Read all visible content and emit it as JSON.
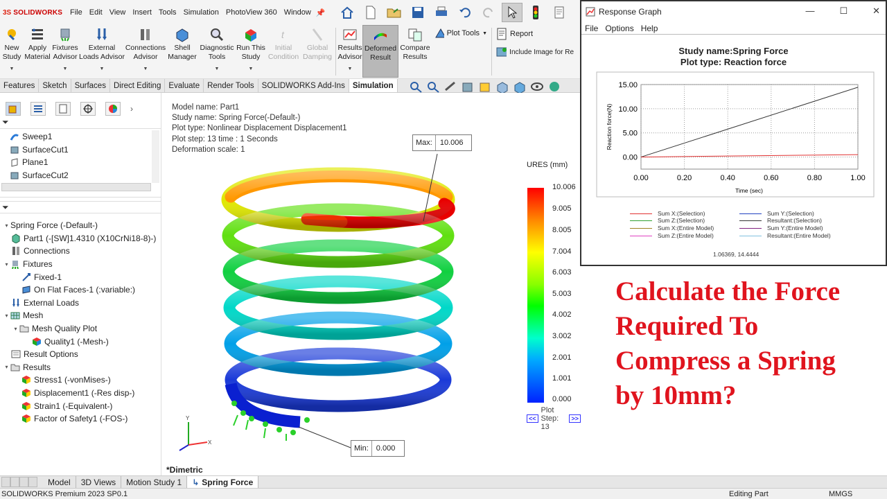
{
  "app": {
    "logo_prefix": "3S",
    "logo_text": "SOLIDWORKS",
    "menu": [
      "File",
      "Edit",
      "View",
      "Insert",
      "Tools",
      "Simulation",
      "PhotoView 360",
      "Window"
    ],
    "status_left": "SOLIDWORKS Premium 2023 SP0.1",
    "status_mid": "Editing Part",
    "status_units": "MMGS"
  },
  "commands": {
    "new_study": [
      "New",
      "Study"
    ],
    "apply_material": [
      "Apply",
      "Material"
    ],
    "fixtures_advisor": [
      "Fixtures",
      "Advisor"
    ],
    "external_loads_advisor": [
      "External",
      "Loads Advisor"
    ],
    "connections_advisor": [
      "Connections",
      "Advisor"
    ],
    "shell_manager": [
      "Shell",
      "Manager"
    ],
    "diagnostic_tools": [
      "Diagnostic",
      "Tools"
    ],
    "run_study": [
      "Run This",
      "Study"
    ],
    "initial_condition": [
      "Initial",
      "Condition"
    ],
    "global_damping": [
      "Global",
      "Damping"
    ],
    "results_advisor": [
      "Results",
      "Advisor"
    ],
    "deformed_result": [
      "Deformed",
      "Result"
    ],
    "compare_results": [
      "Compare",
      "Results"
    ],
    "plot_tools": "Plot Tools",
    "report": "Report",
    "include_image": "Include Image for Re"
  },
  "tabs": [
    "Features",
    "Sketch",
    "Surfaces",
    "Direct Editing",
    "Evaluate",
    "Render Tools",
    "SOLIDWORKS Add-Ins",
    "Simulation"
  ],
  "feature_tree": [
    "Sweep1",
    "SurfaceCut1",
    "Plane1",
    "SurfaceCut2"
  ],
  "study_tree": {
    "root": "Spring Force (-Default-)",
    "part": "Part1 (-[SW]1.4310 (X10CrNi18-8)-)",
    "connections": "Connections",
    "fixtures": "Fixtures",
    "fixed": "Fixed-1",
    "flat_faces": "On Flat Faces-1 (:variable:)",
    "external_loads": "External Loads",
    "mesh": "Mesh",
    "mesh_quality_plot": "Mesh Quality Plot",
    "quality1": "Quality1 (-Mesh-)",
    "result_options": "Result Options",
    "results": "Results",
    "stress": "Stress1 (-vonMises-)",
    "displacement": "Displacement1 (-Res disp-)",
    "strain": "Strain1 (-Equivalent-)",
    "fos": "Factor of Safety1 (-FOS-)"
  },
  "plot_info": {
    "model_name": "Model name: Part1",
    "study_name": "Study name: Spring Force(-Default-)",
    "plot_type": "Plot type: Nonlinear Displacement Displacement1",
    "plot_step": "Plot step: 13   time : 1 Seconds",
    "deformation_scale": "Deformation scale: 1"
  },
  "callouts": {
    "max_label": "Max:",
    "max_value": "10.006",
    "min_label": "Min:",
    "min_value": "0.000"
  },
  "legend": {
    "title": "URES (mm)",
    "ticks": [
      "10.006",
      "9.005",
      "8.005",
      "7.004",
      "6.003",
      "5.003",
      "4.002",
      "3.002",
      "2.001",
      "1.001",
      "0.000"
    ],
    "plot_step_label": "Plot Step: 13",
    "prev": "<<",
    "next": ">>"
  },
  "view_label": "*Dimetric",
  "triad": {
    "x": "X",
    "y": "Y"
  },
  "bottom_tabs": [
    "Model",
    "3D Views",
    "Motion Study 1",
    "Spring Force"
  ],
  "response_graph": {
    "window_title": "Response Graph",
    "menu": [
      "File",
      "Options",
      "Help"
    ],
    "coords": "1.06369, 14.4444"
  },
  "chart_data": {
    "type": "line",
    "title": "Study name:Spring Force",
    "subtitle": "Plot type: Reaction force",
    "xlabel": "Time (sec)",
    "ylabel": "Reaction force(N)",
    "xlim": [
      0,
      1
    ],
    "ylim": [
      -2.5,
      15
    ],
    "xticks": [
      "0.00",
      "0.20",
      "0.40",
      "0.60",
      "0.80",
      "1.00"
    ],
    "yticks": [
      "15.00",
      "10.00",
      "5.00",
      "0.00"
    ],
    "x": [
      0.0,
      1.0
    ],
    "series": [
      {
        "name": "Resultant:(Selection)",
        "color": "#333333",
        "values": [
          0.0,
          14.44
        ]
      },
      {
        "name": "Sum X:(Selection)",
        "color": "#e03030",
        "values": [
          0.0,
          0.5
        ]
      }
    ],
    "legend": [
      {
        "name": "Sum X:(Selection)",
        "color": "#e03030"
      },
      {
        "name": "Sum Y:(Selection)",
        "color": "#2040c0"
      },
      {
        "name": "Sum Z:(Selection)",
        "color": "#30a030"
      },
      {
        "name": "Resultant:(Selection)",
        "color": "#333333"
      },
      {
        "name": "Sum X:(Entire Model)",
        "color": "#a08020"
      },
      {
        "name": "Sum Y:(Entire Model)",
        "color": "#802080"
      },
      {
        "name": "Sum Z:(Entire Model)",
        "color": "#e040c0"
      },
      {
        "name": "Resultant:(Entire Model)",
        "color": "#80c0e0"
      }
    ],
    "grid": true
  },
  "headline": [
    "Calculate the Force",
    "Required To",
    "Compress a Spring",
    "by 10mm?"
  ]
}
